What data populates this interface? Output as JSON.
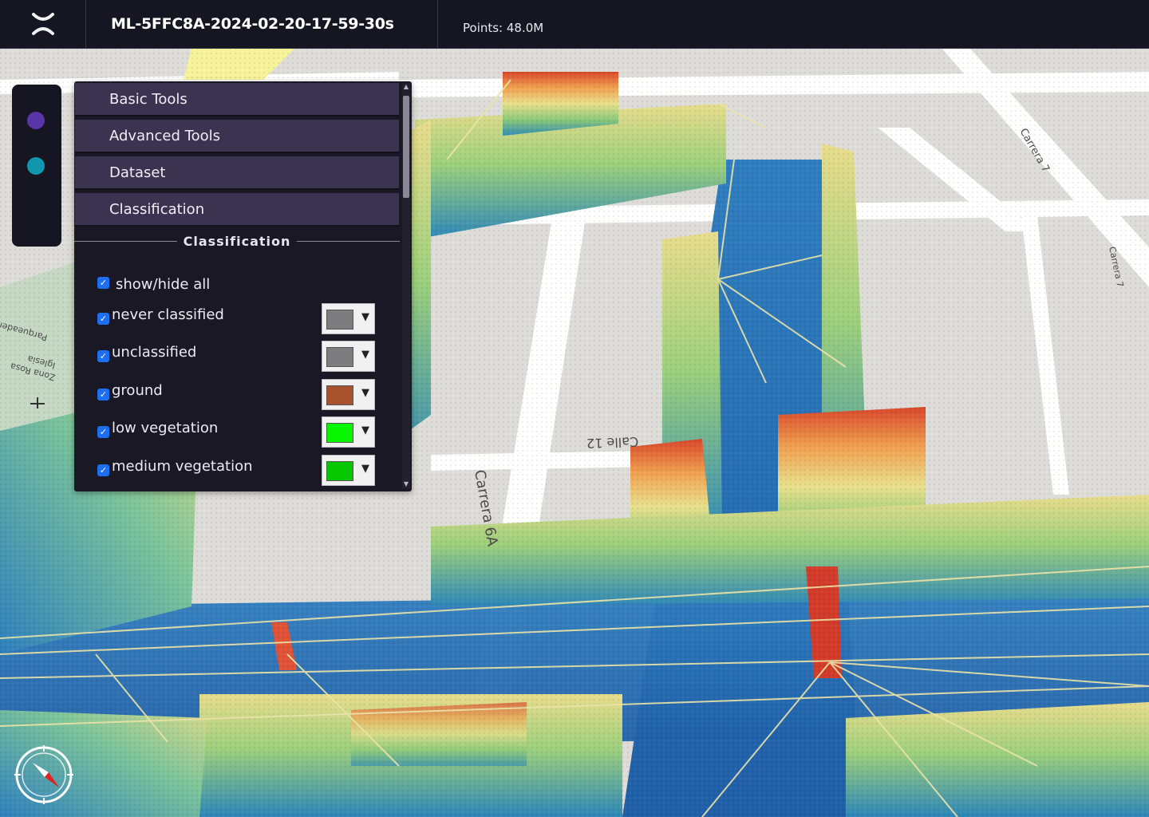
{
  "app": {
    "title": "ML-5FFC8A-2024-02-20-17-59-30s",
    "points": "Points: 48.0M"
  },
  "map_labels": {
    "carrera_6a": "Carrera 6A",
    "calle_12": "Calle 12",
    "carrera_7_a": "Carrera 7",
    "carrera_7_b": "Carrera 7",
    "iglesia": "Iglesia",
    "parqueadero": "Parqueadero",
    "block_text": "Zona Rosa"
  },
  "panel": {
    "accordions": [
      {
        "label": "Basic Tools"
      },
      {
        "label": "Advanced Tools"
      },
      {
        "label": "Dataset"
      },
      {
        "label": "Classification"
      }
    ],
    "section_title": "Classification",
    "show_hide_all": {
      "label": "show/hide all",
      "checked": true
    },
    "classes": [
      {
        "label": "never classified",
        "checked": true,
        "color": "#7d7d7f"
      },
      {
        "label": "unclassified",
        "checked": true,
        "color": "#7d7d7f"
      },
      {
        "label": "ground",
        "checked": true,
        "color": "#a8522e"
      },
      {
        "label": "low vegetation",
        "checked": true,
        "color": "#08f700"
      },
      {
        "label": "medium vegetation",
        "checked": true,
        "color": "#06c800"
      }
    ]
  },
  "icons": {
    "logo": "x-logo-icon",
    "compass": "compass-icon",
    "dropdown": "chevron-down-icon"
  }
}
